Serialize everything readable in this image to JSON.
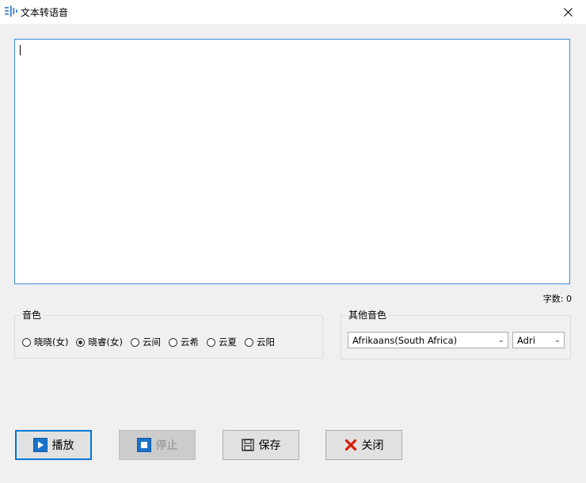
{
  "window": {
    "title": "文本转语音",
    "close_glyph": "✕"
  },
  "editor": {
    "text": ""
  },
  "counter": {
    "label": "字数: 0"
  },
  "voice_group": {
    "title": "音色",
    "options": [
      "晓晓(女)",
      "晓睿(女)",
      "云间",
      "云希",
      "云夏",
      "云阳"
    ],
    "selected_index": 1
  },
  "other_group": {
    "title": "其他音色",
    "language_select": "Afrikaans(South Africa)",
    "voice_select": "Adri"
  },
  "buttons": {
    "play": "播放",
    "stop": "停止",
    "save": "保存",
    "close": "关闭"
  },
  "colors": {
    "accent": "#0078d7",
    "close_red": "#d81e06"
  }
}
